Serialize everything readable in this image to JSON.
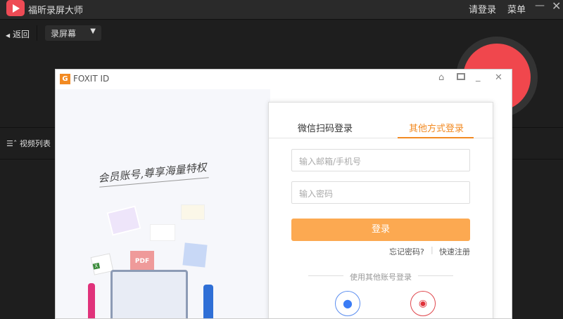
{
  "app": {
    "title": "福昕录屏大师",
    "login": "请登录",
    "menu": "菜单"
  },
  "toolbar": {
    "back": "返回",
    "mode": "录屏幕"
  },
  "list": {
    "label": "视频列表"
  },
  "dialog": {
    "title": "FOXIT ID",
    "slogan": "会员账号,尊享海量特权",
    "tabs": [
      {
        "label": "微信扫码登录"
      },
      {
        "label": "其他方式登录"
      }
    ],
    "email_placeholder": "输入邮箱/手机号",
    "password_placeholder": "输入密码",
    "login_button": "登录",
    "forgot": "忘记密码?",
    "register": "快速注册",
    "other_login": "使用其他账号登录",
    "accent": "#f28a22"
  }
}
